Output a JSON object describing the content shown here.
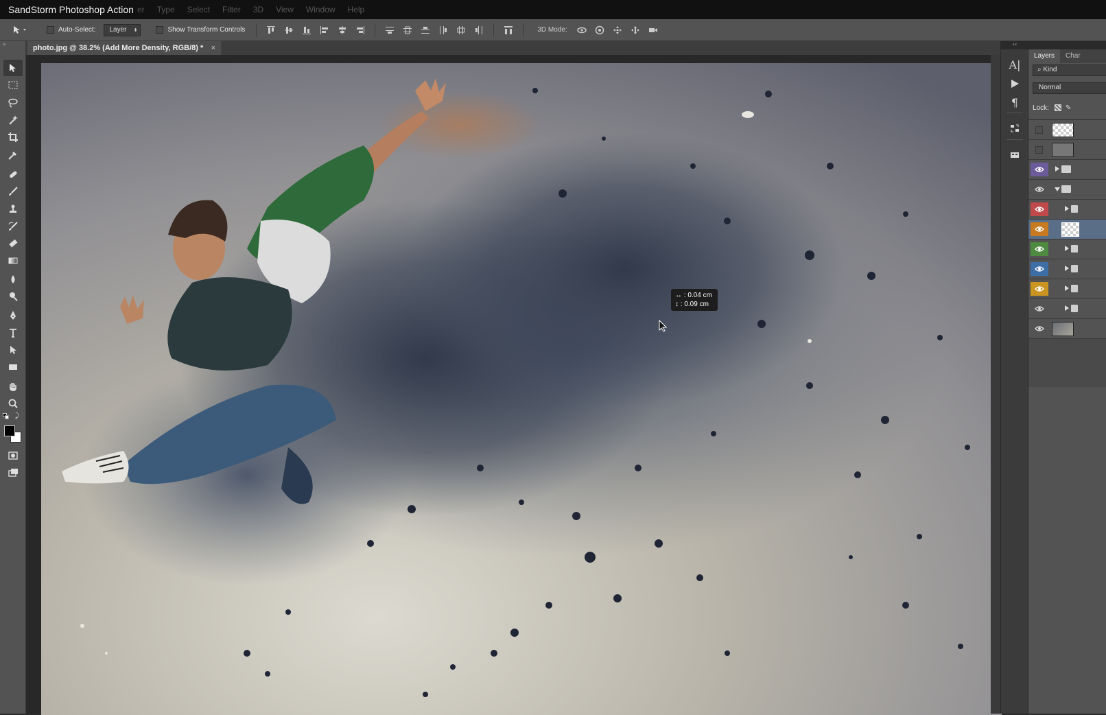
{
  "app": {
    "title": "SandStorm Photoshop Action"
  },
  "menu": {
    "items": [
      "er",
      "Type",
      "Select",
      "Filter",
      "3D",
      "View",
      "Window",
      "Help"
    ]
  },
  "options_bar": {
    "auto_select_label": "Auto-Select:",
    "auto_select_value": "Layer",
    "show_transform_label": "Show Transform Controls",
    "mode_3d_label": "3D Mode:"
  },
  "document": {
    "tab_title": "photo.jpg @ 38.2% (Add More Density, RGB/8) *",
    "close_glyph": "×"
  },
  "measure_tooltip": {
    "horizontal": "0.04 cm",
    "vertical": "0.09 cm",
    "h_glyph": "↔",
    "v_glyph": "↕"
  },
  "dock": {
    "icons": [
      "character-icon",
      "play-action-icon",
      "paragraph-icon",
      "adjust-icon",
      "properties-icon"
    ],
    "collapse_glyph": "‹‹"
  },
  "layers_panel": {
    "tabs": [
      "Layers",
      "Char"
    ],
    "kind_label": "Kind",
    "blend_mode": "Normal",
    "lock_label": "Lock:",
    "layers": [
      {
        "eye": false,
        "color": "",
        "type": "checker"
      },
      {
        "eye": false,
        "color": "",
        "type": "gray"
      },
      {
        "eye": true,
        "color": "#6b5b9a",
        "type": "folder-collapsed"
      },
      {
        "eye": true,
        "color": "",
        "type": "folder-open"
      },
      {
        "eye": true,
        "color": "#c0494b",
        "type": "group"
      },
      {
        "eye": true,
        "color": "#c77a1f",
        "type": "selected-checker"
      },
      {
        "eye": true,
        "color": "#4e8a3f",
        "type": "group"
      },
      {
        "eye": true,
        "color": "#3e6ea6",
        "type": "group"
      },
      {
        "eye": true,
        "color": "#c9941f",
        "type": "group"
      },
      {
        "eye": true,
        "color": "",
        "type": "group"
      },
      {
        "eye": true,
        "color": "",
        "type": "photo"
      }
    ]
  },
  "colors": {
    "foreground": "#000000",
    "background": "#ffffff"
  }
}
